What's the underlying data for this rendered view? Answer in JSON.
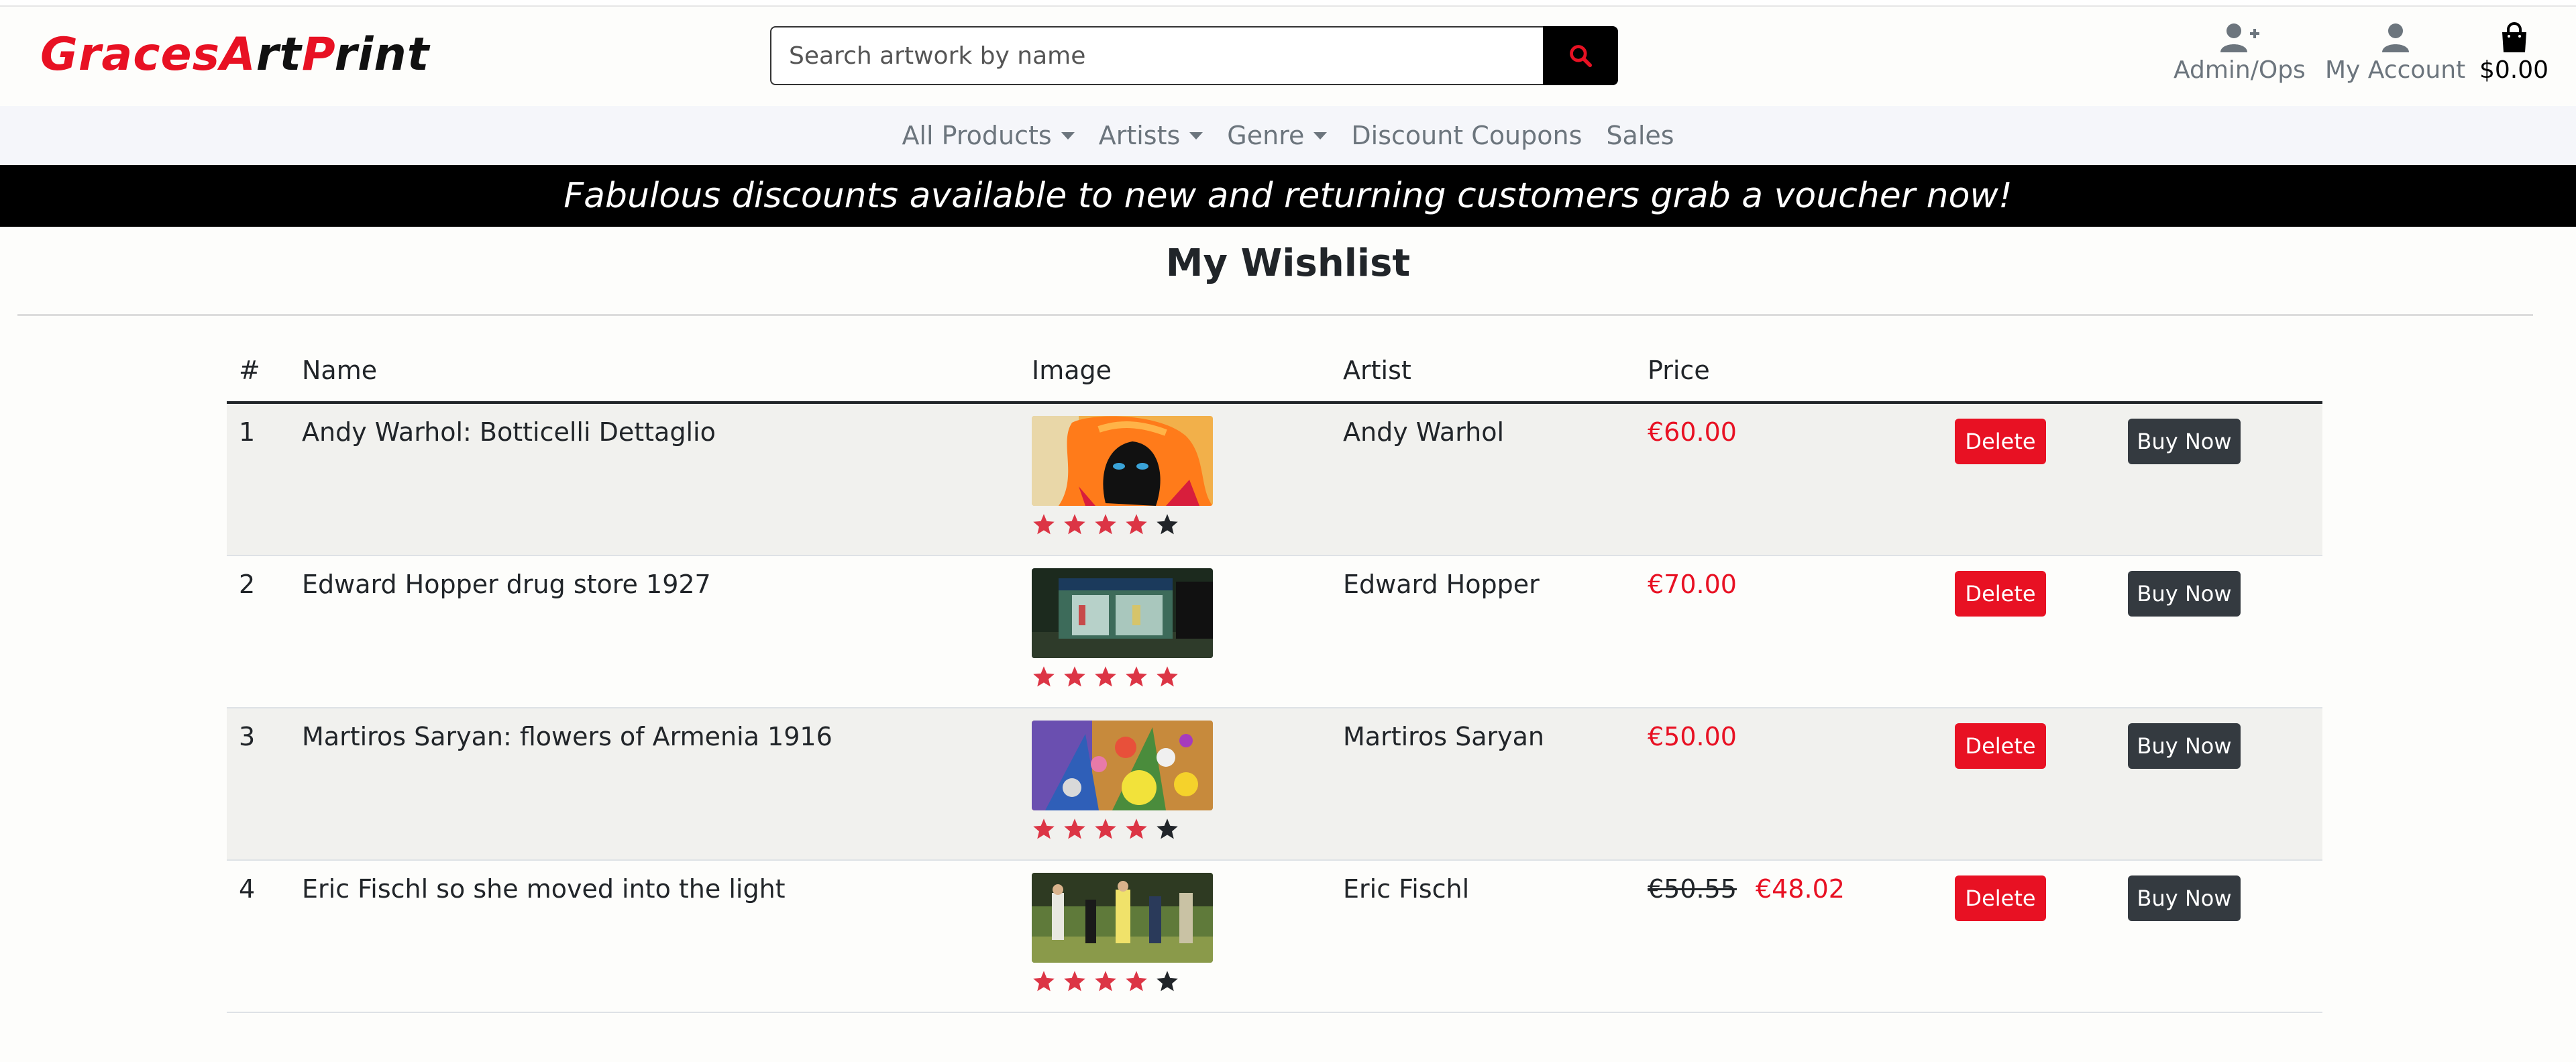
{
  "header": {
    "logo": {
      "part1": "Graces",
      "part2": "A",
      "part3": "rt",
      "part4": "P",
      "part5": "rint"
    },
    "search": {
      "placeholder": "Search artwork by name"
    },
    "admin_label": "Admin/Ops",
    "account_label": "My Account",
    "bag_total": "$0.00"
  },
  "nav": {
    "items": [
      {
        "label": "All Products",
        "dropdown": true
      },
      {
        "label": "Artists",
        "dropdown": true
      },
      {
        "label": "Genre",
        "dropdown": true
      },
      {
        "label": "Discount Coupons",
        "dropdown": false
      },
      {
        "label": "Sales",
        "dropdown": false
      }
    ]
  },
  "banner": {
    "text": "Fabulous discounts available to new and returning customers grab a voucher now!"
  },
  "page": {
    "title": "My Wishlist"
  },
  "table": {
    "headers": {
      "num": "#",
      "name": "Name",
      "image": "Image",
      "artist": "Artist",
      "price": "Price"
    },
    "delete_label": "Delete",
    "buy_label": "Buy Now",
    "rows": [
      {
        "num": "1",
        "name": "Andy Warhol: Botticelli Dettaglio",
        "artist": "Andy Warhol",
        "old_price": "",
        "price": "€60.00",
        "rating": 4
      },
      {
        "num": "2",
        "name": "Edward Hopper drug store 1927",
        "artist": "Edward Hopper",
        "old_price": "",
        "price": "€70.00",
        "rating": 5
      },
      {
        "num": "3",
        "name": "Martiros Saryan: flowers of Armenia 1916",
        "artist": "Martiros Saryan",
        "old_price": "",
        "price": "€50.00",
        "rating": 4
      },
      {
        "num": "4",
        "name": "Eric Fischl so she moved into the light",
        "artist": "Eric Fischl",
        "old_price": "€50.55",
        "price": "€48.02",
        "rating": 4
      }
    ]
  },
  "colors": {
    "accent_red": "#e81123",
    "star_red": "#dc3545",
    "star_empty": "#212529",
    "dark_button": "#343a40"
  }
}
